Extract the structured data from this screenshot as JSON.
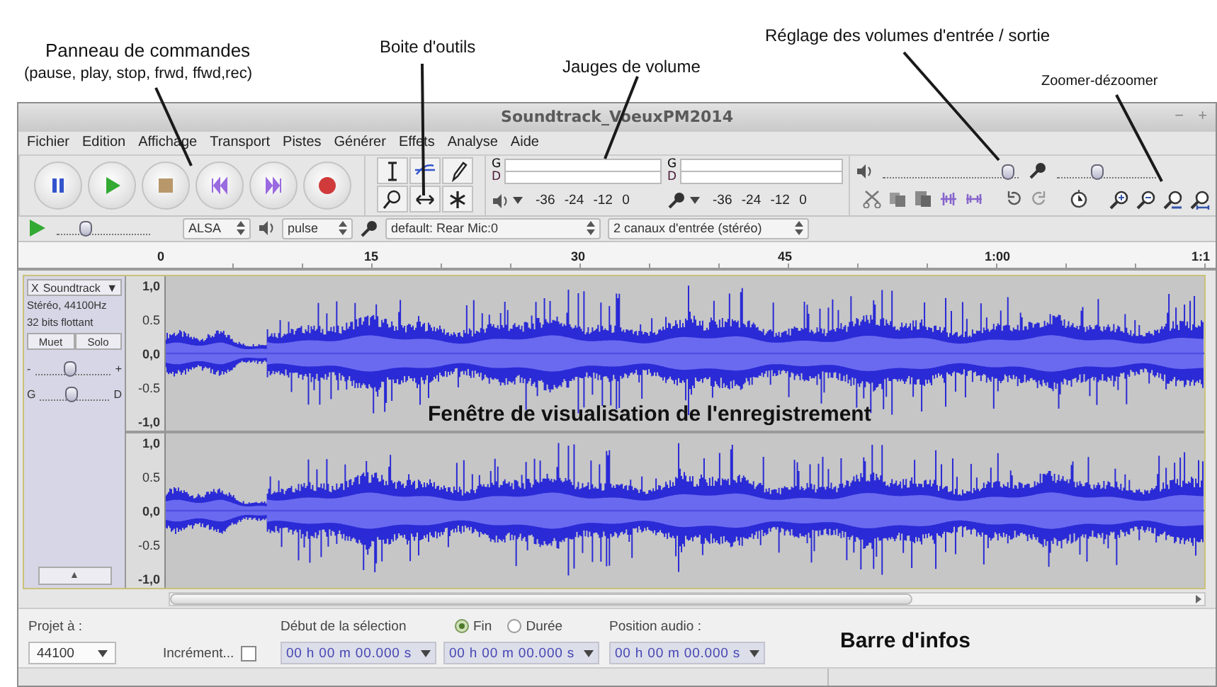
{
  "annotations": [
    "Panneau de commandes",
    "(pause, play, stop, frwd, ffwd,rec)",
    "Boite d'outils",
    "Jauges de volume",
    "Réglage des volumes d'entrée / sortie",
    "Zoomer-dézoomer",
    "Fenêtre de visualisation de l'enregistrement",
    "Barre d'infos"
  ],
  "window": {
    "title": "Soundtrack_VoeuxPM2014",
    "controls": [
      "−",
      "+"
    ]
  },
  "menu": [
    "Fichier",
    "Edition",
    "Affichage",
    "Transport",
    "Pistes",
    "Générer",
    "Effets",
    "Analyse",
    "Aide"
  ],
  "meters": [
    {
      "channels": [
        "G",
        "D"
      ],
      "scale": "-36 -24 -12 0"
    },
    {
      "channels": [
        "G",
        "D"
      ],
      "scale": "-36 -24 -12 0"
    }
  ],
  "mixer": [
    {
      "level": 0.92
    },
    {
      "level": 0.4
    }
  ],
  "play_speed": {
    "level": 0.3
  },
  "devices": [
    "ALSA",
    "pulse",
    "default: Rear Mic:0",
    "2 canaux d'entrée (stéréo)"
  ],
  "ruler": [
    "0",
    "15",
    "30",
    "45",
    "1:00",
    "1:1"
  ],
  "track": {
    "close": "X",
    "name": "Soundtrack",
    "menu": "▼",
    "info": [
      "Stéréo, 44100Hz",
      "32 bits flottant"
    ],
    "buttons": [
      "Muet",
      "Solo"
    ],
    "gain": {
      "min": "-",
      "max": "+",
      "level": 0.45
    },
    "pan": {
      "left": "G",
      "right": "D",
      "level": 0.45
    },
    "collapse": "▲",
    "channels": [
      {
        "scale": [
          "1,0",
          "0.5",
          "0,0",
          "-0.5",
          "-1,0"
        ]
      },
      {
        "scale": [
          "1,0",
          "0.5",
          "0,0",
          "-0.5",
          "-1,0"
        ]
      }
    ]
  },
  "selection_bar": {
    "rate_label": "Projet à :",
    "rate": "44100",
    "snap_label": "Incrément...",
    "snap_checked": false,
    "start_label": "Début de la sélection",
    "modes": [
      {
        "label": "Fin",
        "selected": true
      },
      {
        "label": "Durée",
        "selected": false
      }
    ],
    "position_label": "Position audio :",
    "times": [
      "00 h 00 m 00.000 s",
      "00 h 00 m 00.000 s",
      "00 h 00 m 00.000 s"
    ]
  }
}
